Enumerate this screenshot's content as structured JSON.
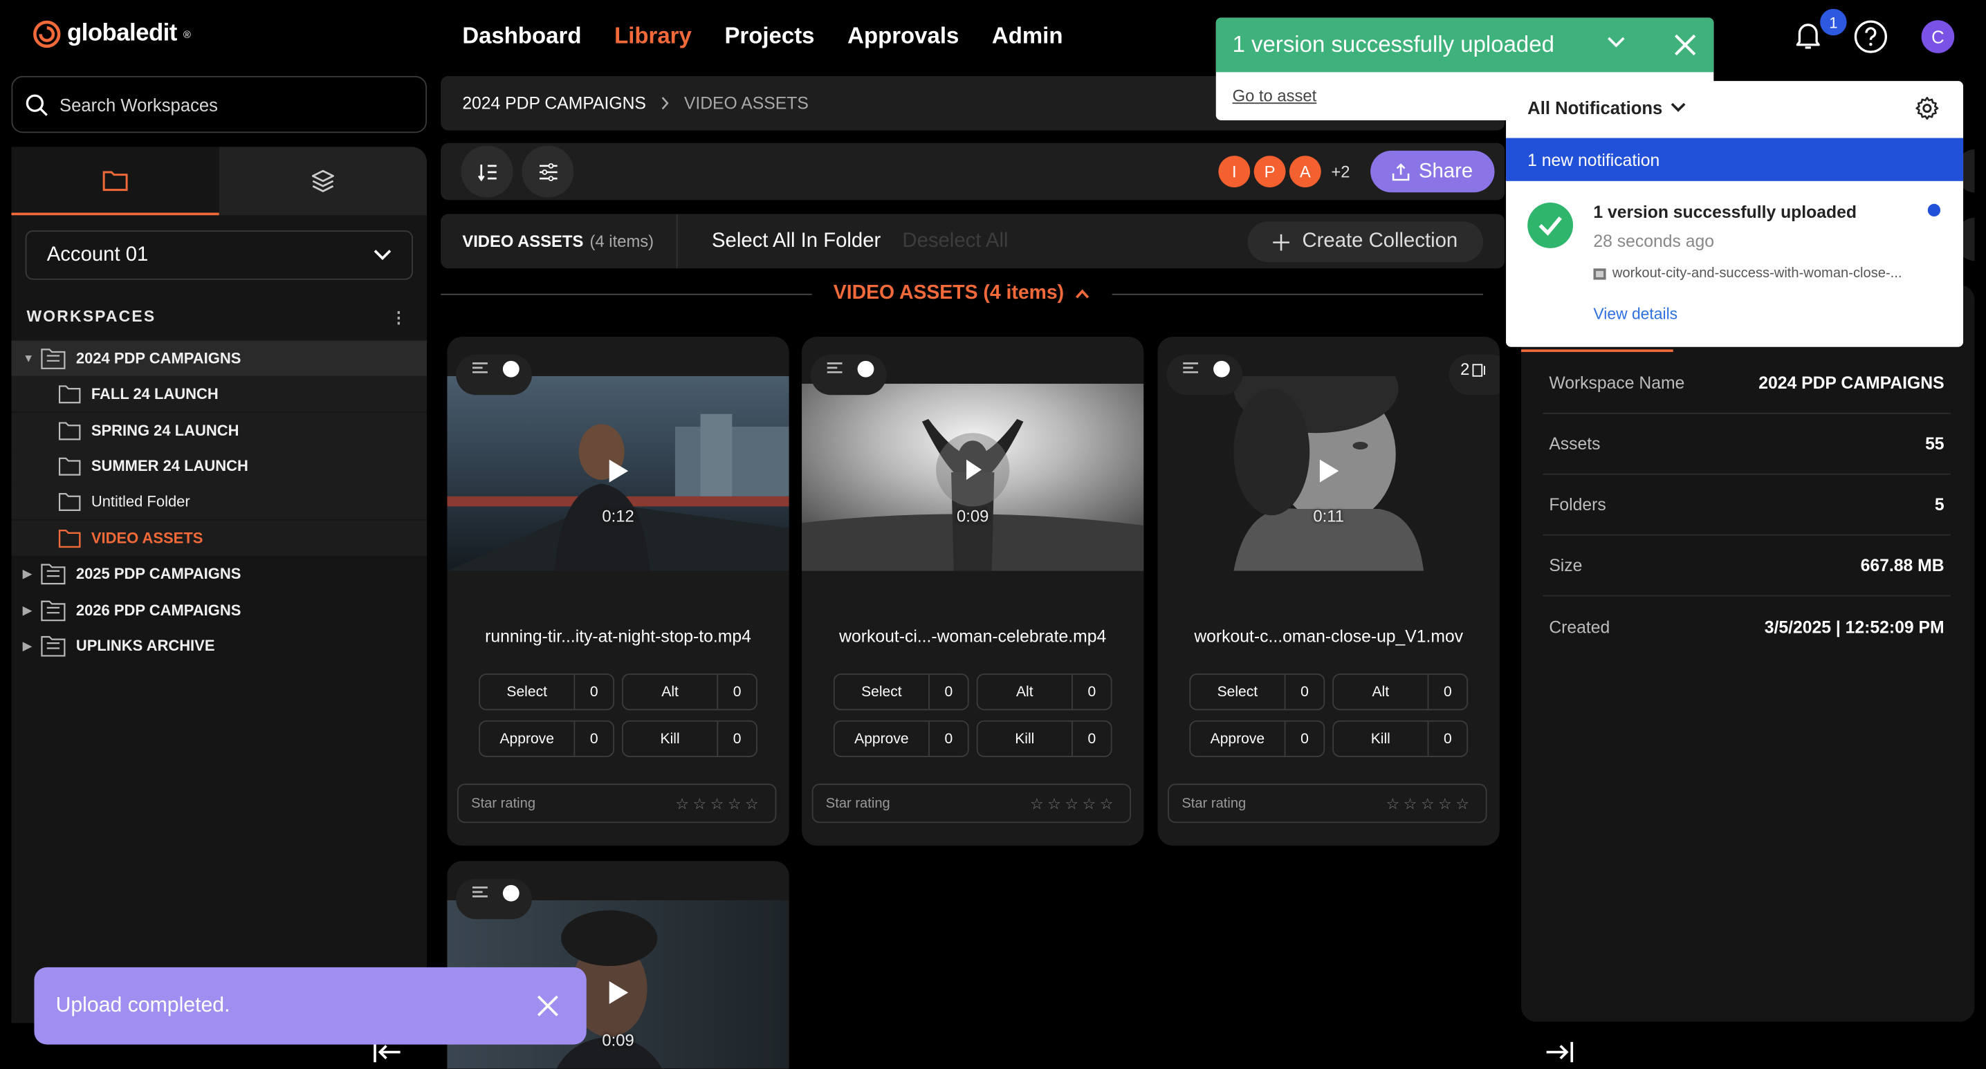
{
  "header": {
    "brand": "globaledit",
    "brand_mark": "®",
    "nav": [
      "Dashboard",
      "Library",
      "Projects",
      "Approvals",
      "Admin"
    ],
    "active_nav": "Library",
    "notification_count": "1",
    "user_initial": "C"
  },
  "sidebar": {
    "search_placeholder": "Search Workspaces",
    "account": "Account 01",
    "workspaces_heading": "WORKSPACES",
    "tree": [
      {
        "label": "2024 PDP CAMPAIGNS"
      },
      {
        "label": "FALL 24 LAUNCH"
      },
      {
        "label": "SPRING 24 LAUNCH"
      },
      {
        "label": "SUMMER 24 LAUNCH"
      },
      {
        "label": "Untitled Folder"
      },
      {
        "label": "VIDEO ASSETS"
      },
      {
        "label": "2025 PDP CAMPAIGNS"
      },
      {
        "label": "2026 PDP CAMPAIGNS"
      },
      {
        "label": "UPLINKS ARCHIVE"
      }
    ]
  },
  "breadcrumb": {
    "parent": "2024 PDP CAMPAIGNS",
    "current": "VIDEO ASSETS"
  },
  "toolbar": {
    "collaborators": [
      "I",
      "P",
      "A"
    ],
    "more": "+2",
    "share": "Share"
  },
  "selection": {
    "folder": "VIDEO ASSETS",
    "count": "(4 items)",
    "select_all": "Select All In Folder",
    "deselect_all": "Deselect All",
    "create_collection": "Create Collection"
  },
  "section": {
    "label": "VIDEO ASSETS (4 items)"
  },
  "cards": [
    {
      "duration": "0:12",
      "filename": "running-tir...ity-at-night-stop-to.mp4",
      "select": "Select",
      "select_n": "0",
      "alt": "Alt",
      "alt_n": "0",
      "approve": "Approve",
      "approve_n": "0",
      "kill": "Kill",
      "kill_n": "0",
      "star_label": "Star rating",
      "version": ""
    },
    {
      "duration": "0:09",
      "filename": "workout-ci...-woman-celebrate.mp4",
      "select": "Select",
      "select_n": "0",
      "alt": "Alt",
      "alt_n": "0",
      "approve": "Approve",
      "approve_n": "0",
      "kill": "Kill",
      "kill_n": "0",
      "star_label": "Star rating",
      "version": ""
    },
    {
      "duration": "0:11",
      "filename": "workout-c...oman-close-up_V1.mov",
      "select": "Select",
      "select_n": "0",
      "alt": "Alt",
      "alt_n": "0",
      "approve": "Approve",
      "approve_n": "0",
      "kill": "Kill",
      "kill_n": "0",
      "star_label": "Star rating",
      "version": "2"
    },
    {
      "duration": "0:09"
    }
  ],
  "details": [
    {
      "key": "Workspace Name",
      "value": "2024 PDP CAMPAIGNS"
    },
    {
      "key": "Assets",
      "value": "55"
    },
    {
      "key": "Folders",
      "value": "5"
    },
    {
      "key": "Size",
      "value": "667.88 MB"
    },
    {
      "key": "Created",
      "value": "3/5/2025 | 12:52:09 PM"
    }
  ],
  "toast": {
    "message": "1 version successfully uploaded",
    "link": "Go to asset"
  },
  "notifications": {
    "filter": "All Notifications",
    "new_banner": "1 new notification",
    "item_title": "1 version successfully uploaded",
    "item_time": "28 seconds ago",
    "item_file": "workout-city-and-success-with-woman-close-...",
    "view_details": "View details"
  },
  "upload_toast": {
    "message": "Upload completed."
  },
  "colors": {
    "accent": "#f36a3a",
    "share": "#8b74e6",
    "success": "#3fb27c",
    "blue": "#2151d8"
  }
}
